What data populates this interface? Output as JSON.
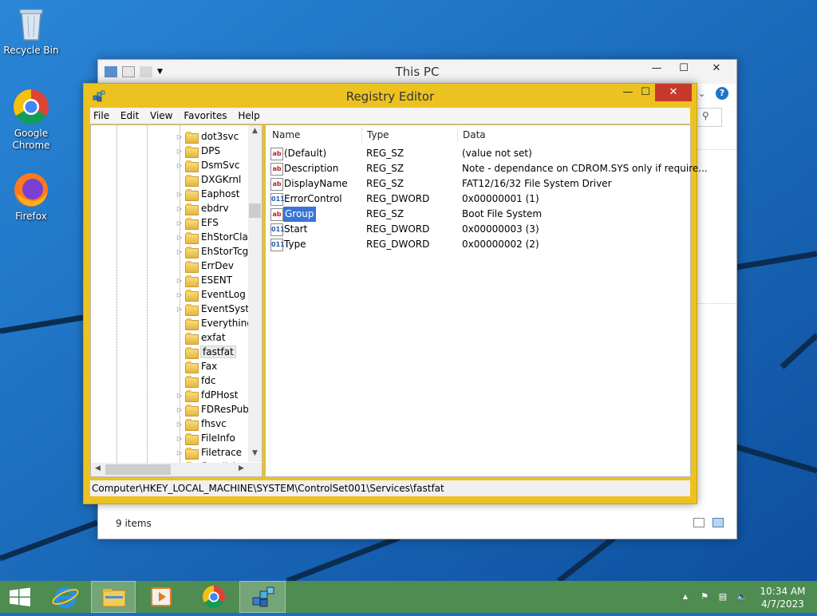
{
  "desktop": {
    "icons": [
      {
        "label": "Recycle Bin"
      },
      {
        "label": "Google Chrome"
      },
      {
        "label": "Firefox"
      }
    ]
  },
  "thispc": {
    "title": "This PC",
    "status": "9 items"
  },
  "regedit": {
    "title": "Registry Editor",
    "menu": [
      "File",
      "Edit",
      "View",
      "Favorites",
      "Help"
    ],
    "tree": [
      "dot3svc",
      "DPS",
      "DsmSvc",
      "DXGKrnl",
      "Eaphost",
      "ebdrv",
      "EFS",
      "EhStorClas",
      "EhStorTcgI",
      "ErrDev",
      "ESENT",
      "EventLog",
      "EventSyste",
      "Everything",
      "exfat",
      "fastfat",
      "Fax",
      "fdc",
      "fdPHost",
      "FDResPub",
      "fhsvc",
      "FileInfo",
      "Filetrace",
      "flpydisk"
    ],
    "columns": {
      "name": "Name",
      "type": "Type",
      "data": "Data"
    },
    "values": [
      {
        "name": "(Default)",
        "type": "REG_SZ",
        "data": "(value not set)",
        "icon": "ab"
      },
      {
        "name": "Description",
        "type": "REG_SZ",
        "data": "Note - dependance on CDROM.SYS only if require...",
        "icon": "ab"
      },
      {
        "name": "DisplayName",
        "type": "REG_SZ",
        "data": "FAT12/16/32 File System Driver",
        "icon": "ab"
      },
      {
        "name": "ErrorControl",
        "type": "REG_DWORD",
        "data": "0x00000001 (1)",
        "icon": "bin"
      },
      {
        "name": "Group",
        "type": "REG_SZ",
        "data": "Boot File System",
        "icon": "ab"
      },
      {
        "name": "Start",
        "type": "REG_DWORD",
        "data": "0x00000003 (3)",
        "icon": "bin"
      },
      {
        "name": "Type",
        "type": "REG_DWORD",
        "data": "0x00000002 (2)",
        "icon": "bin"
      }
    ],
    "status_path": "Computer\\HKEY_LOCAL_MACHINE\\SYSTEM\\ControlSet001\\Services\\fastfat"
  },
  "taskbar": {
    "time": "10:34 AM",
    "date": "4/7/2023"
  }
}
